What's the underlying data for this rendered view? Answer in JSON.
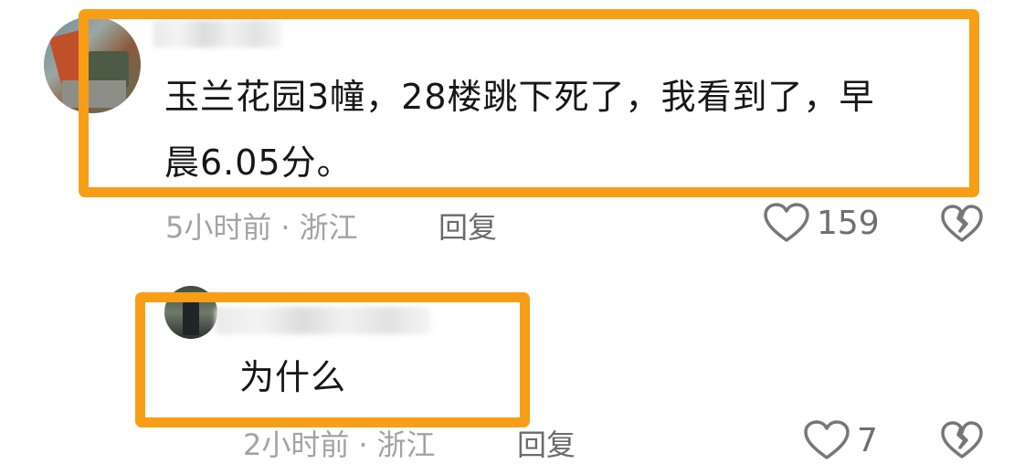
{
  "comments": [
    {
      "text_line1": "玉兰花园3幢，28楼跳下死了，我看到了，早",
      "text_line2": "晨6.05分。",
      "time": "5小时前",
      "separator": "·",
      "location": "浙江",
      "reply_label": "回复",
      "likes": "159",
      "highlight_color": "#f79e16"
    },
    {
      "text": "为什么",
      "time": "2小时前",
      "separator": "·",
      "location": "浙江",
      "reply_label": "回复",
      "likes": "7",
      "highlight_color": "#f79e16"
    }
  ],
  "icons": {
    "like": "heart-outline-icon",
    "dislike": "broken-heart-icon"
  }
}
